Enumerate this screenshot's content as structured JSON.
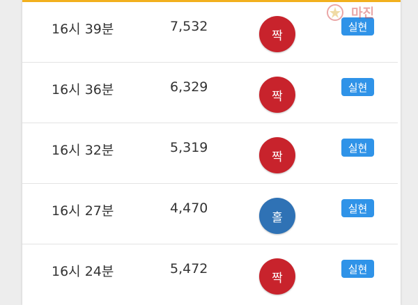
{
  "watermark": {
    "text": "마진"
  },
  "colors": {
    "accent_bar": "#f2b01e",
    "ball_red": "#c8232c",
    "ball_blue": "#2f72b5",
    "badge_blue": "#2f93e8"
  },
  "rows": [
    {
      "time": "16시 39분",
      "value": "7,532",
      "ball": "짝",
      "ball_color": "red",
      "status": "실현"
    },
    {
      "time": "16시 36분",
      "value": "6,329",
      "ball": "짝",
      "ball_color": "red",
      "status": "실현"
    },
    {
      "time": "16시 32분",
      "value": "5,319",
      "ball": "짝",
      "ball_color": "red",
      "status": "실현"
    },
    {
      "time": "16시 27분",
      "value": "4,470",
      "ball": "홀",
      "ball_color": "blue",
      "status": "실현"
    },
    {
      "time": "16시 24분",
      "value": "5,472",
      "ball": "짝",
      "ball_color": "red",
      "status": "실현"
    }
  ]
}
